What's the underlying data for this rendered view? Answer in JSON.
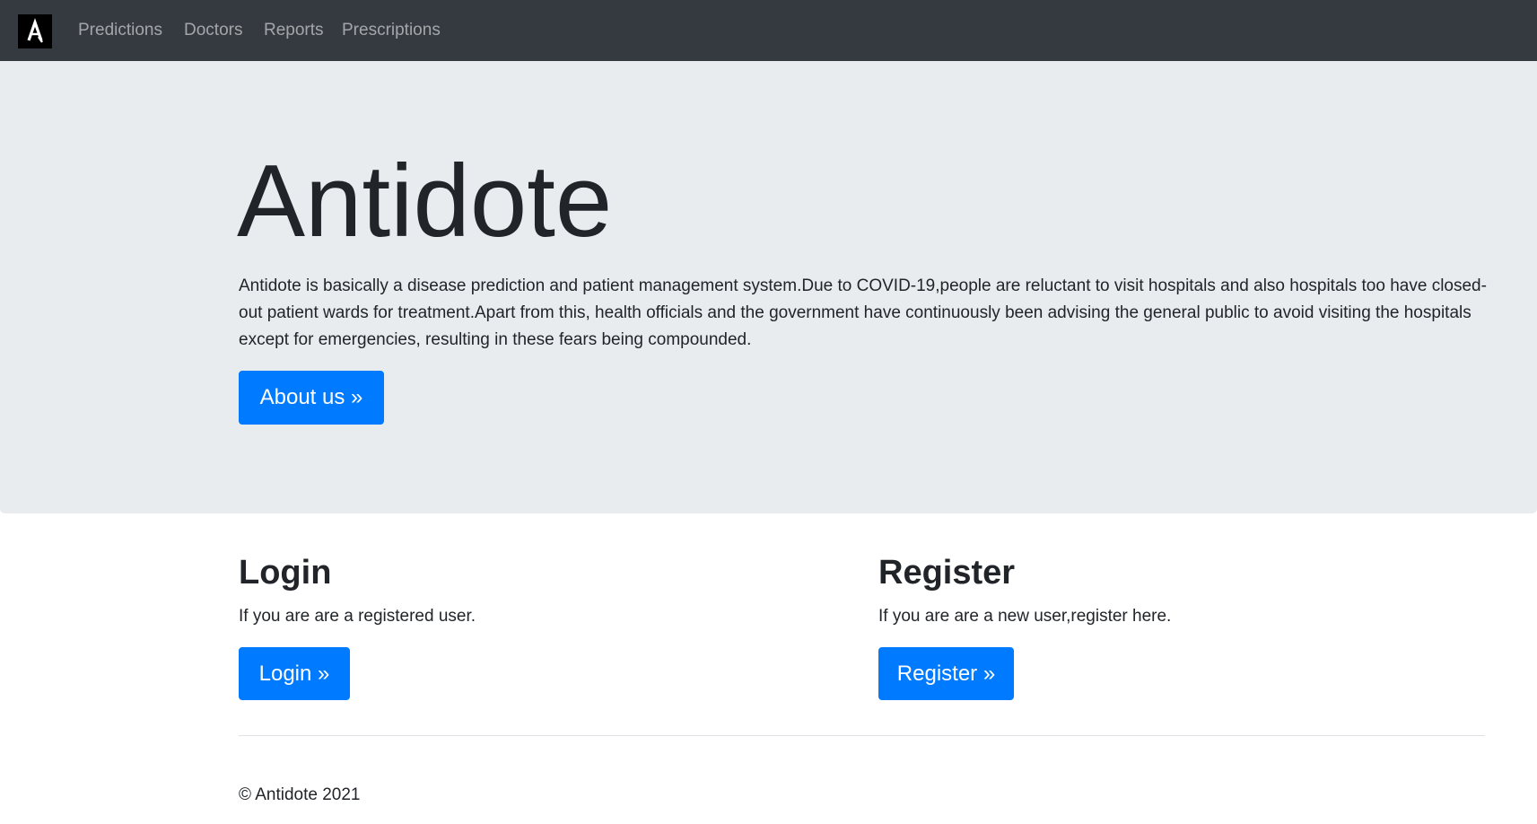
{
  "navbar": {
    "logo_icon": "antidote-logo-icon",
    "background": "#343a40",
    "links": [
      {
        "label": "Predictions"
      },
      {
        "label": "Doctors"
      },
      {
        "label": "Reports"
      },
      {
        "label": "Prescriptions"
      }
    ]
  },
  "hero": {
    "title": "Antidote",
    "description": "Antidote is basically a disease prediction and patient management system.Due to COVID-19,people are reluctant to visit hospitals and also hospitals too have closed-out patient wards for treatment.Apart from this, health officials and the government have continuously been advising the general public to avoid visiting the hospitals except for emergencies, resulting in these fears being compounded.",
    "button_label": "About us »",
    "background": "#e9ecef"
  },
  "login": {
    "heading": "Login",
    "text": "If you are are a registered user.",
    "button_label": "Login »"
  },
  "register": {
    "heading": "Register",
    "text": "If you are are a new user,register here.",
    "button_label": "Register »"
  },
  "footer": {
    "copyright": "© Antidote 2021"
  },
  "colors": {
    "primary": "#007bff",
    "text": "#212529"
  }
}
